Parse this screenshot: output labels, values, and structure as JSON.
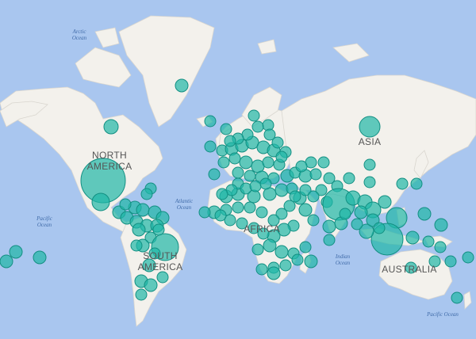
{
  "map": {
    "ocean_labels": {
      "arctic": "Arctic\nOcean",
      "atlantic": "Atlantic\nOcean",
      "pacific_west": "Pacific\nOcean",
      "indian": "Indian\nOcean",
      "pacific_east": "Pacific Ocean"
    },
    "continent_labels": {
      "north_america": "NORTH\nAMERICA",
      "south_america": "SOUTH\nAMERICA",
      "africa": "AFRICA",
      "asia": "ASIA",
      "australia": "AUSTRALIA"
    },
    "colors": {
      "ocean": "#a9c6ef",
      "land": "#f3f1ec",
      "bubble": "#1fb7a6"
    }
  }
}
